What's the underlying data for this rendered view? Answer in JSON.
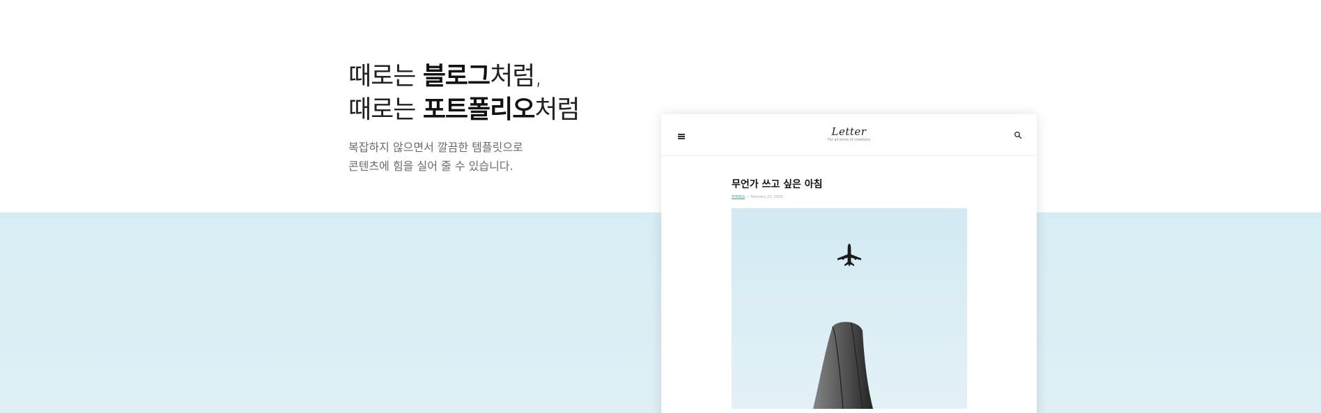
{
  "hero": {
    "line1_prefix": "때로는 ",
    "line1_bold": "블로그",
    "line1_suffix": "처럼,",
    "line2_prefix": "때로는 ",
    "line2_bold": "포트폴리오",
    "line2_suffix": "처럼",
    "sub_line1": "복잡하지 않으면서 깔끔한 템플릿으로",
    "sub_line2": "콘텐츠에 힘을 실어 줄 수 있습니다."
  },
  "mockup": {
    "brand_name": "Letter",
    "brand_tagline": "For all kinds of creations",
    "post": {
      "title": "무언가 쓰고 싶은 아침",
      "category": "THINGS",
      "separator": " — ",
      "date": "February 25, 2018"
    },
    "icons": [
      "menu-icon",
      "search-icon",
      "airplane-icon"
    ]
  },
  "colors": {
    "band": "#d7edf4",
    "accent": "#3aa58f"
  }
}
